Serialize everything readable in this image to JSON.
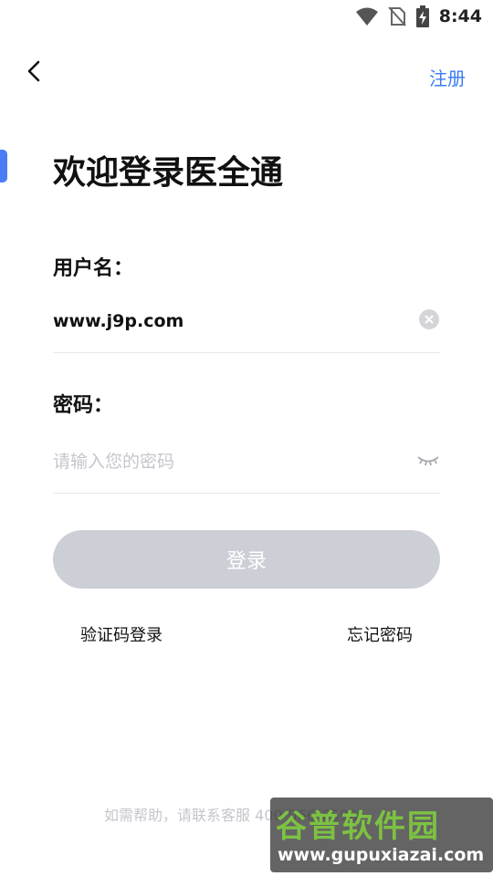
{
  "status_bar": {
    "time": "8:44",
    "icons": [
      "wifi-icon",
      "no-sim-icon",
      "battery-charging-icon"
    ]
  },
  "header": {
    "back_icon": "chevron-left-icon",
    "register_label": "注册"
  },
  "title": "欢迎登录医全通",
  "form": {
    "username_label": "用户名：",
    "username_value": "www.j9p.com",
    "password_label": "密码：",
    "password_placeholder": "请输入您的密码",
    "login_label": "登录"
  },
  "links": {
    "sms_login": "验证码登录",
    "forgot_password": "忘记密码"
  },
  "footer": {
    "help_text": "如需帮助，请联系客服",
    "help_phone": "400-066-6590"
  },
  "watermark": {
    "main": "谷普软件园",
    "sub": "www.gupuxiazai.com"
  },
  "colors": {
    "accent": "#3b7cf2",
    "button_disabled": "#cdcfd6",
    "placeholder": "#c4c6cc"
  }
}
